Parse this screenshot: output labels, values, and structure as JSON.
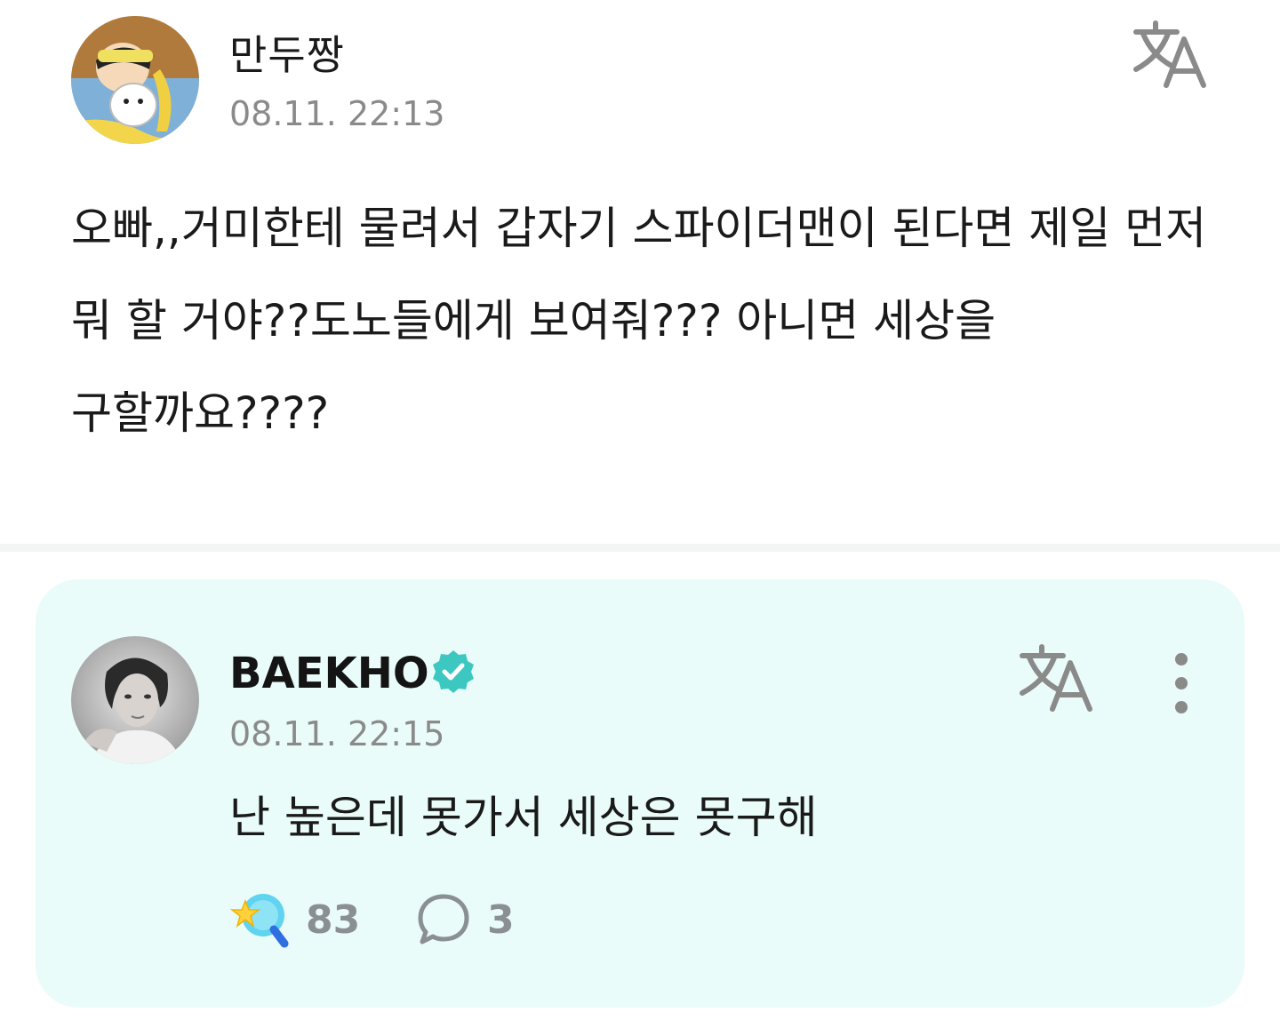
{
  "fan_post": {
    "author": "만두짱",
    "timestamp": "08.11. 22:13",
    "body": "오빠,,거미한테 물려서 갑자기 스파이더맨이 된다면 제일 먼저 뭐 할 거야??도노들에게 보여줘??? 아니면 세상을 구할까요????",
    "avatar_icon": "cartoon-character-avatar",
    "translate_icon": "translate-icon"
  },
  "artist_reply": {
    "author": "BAEKHO",
    "verified_icon": "verified-badge-icon",
    "timestamp": "08.11. 22:15",
    "body": "난 높은데 못가서 세상은 못구해",
    "avatar_icon": "profile-photo-avatar",
    "translate_icon": "translate-icon",
    "more_icon": "more-vertical-icon",
    "like_count": "83",
    "comment_count": "3",
    "like_icon": "star-wand-icon",
    "comment_icon": "comment-bubble-icon"
  },
  "colors": {
    "reply_card_bg": "#e9fcf9",
    "verified": "#3cc8c0",
    "timestamp": "#8a8a8a",
    "count": "#8a8f94"
  }
}
